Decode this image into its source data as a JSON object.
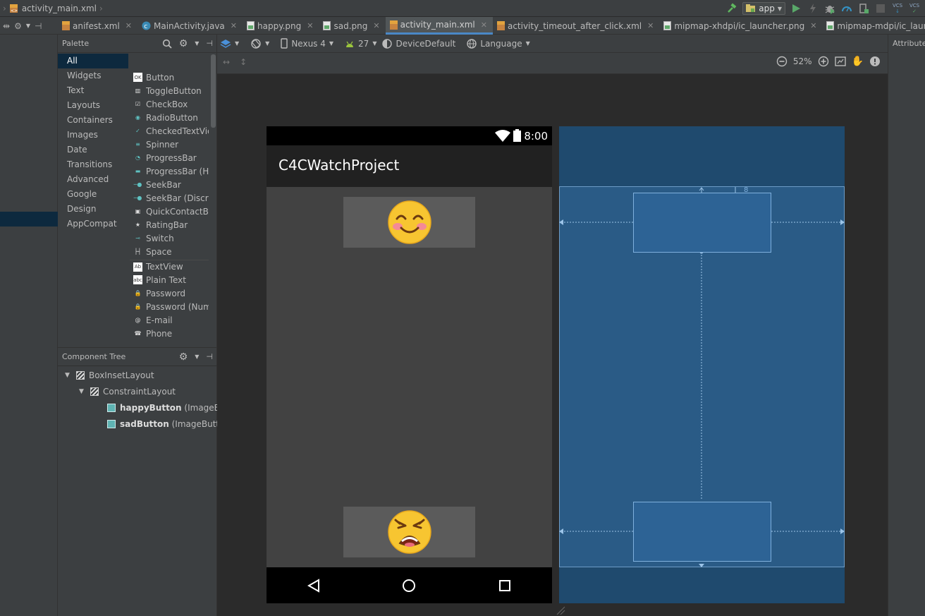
{
  "breadcrumb": {
    "file": "activity_main.xml",
    "separator": "›"
  },
  "run_config": {
    "label": "app"
  },
  "vcs": {
    "label": "VCS"
  },
  "tabs": [
    {
      "label": "anifest.xml",
      "icon": "xml-file-icon",
      "active": false
    },
    {
      "label": "MainActivity.java",
      "icon": "java-class-icon",
      "active": false
    },
    {
      "label": "happy.png",
      "icon": "image-file-icon",
      "active": false
    },
    {
      "label": "sad.png",
      "icon": "image-file-icon",
      "active": false
    },
    {
      "label": "activity_main.xml",
      "icon": "xml-file-icon",
      "active": true
    },
    {
      "label": "activity_timeout_after_click.xml",
      "icon": "xml-file-icon",
      "active": false
    },
    {
      "label": "mipmap-xhdpi/ic_launcher.png",
      "icon": "image-file-icon",
      "active": false
    },
    {
      "label": "mipmap-mdpi/ic_launcher.png",
      "icon": "image-file-icon",
      "active": false
    }
  ],
  "palette": {
    "title": "Palette",
    "categories": [
      "All",
      "Widgets",
      "Text",
      "Layouts",
      "Containers",
      "Images",
      "Date",
      "Transitions",
      "Advanced",
      "Google",
      "Design",
      "AppCompat"
    ],
    "selected_category": "All",
    "widgets": [
      "Button",
      "ToggleButton",
      "CheckBox",
      "RadioButton",
      "CheckedTextView",
      "Spinner",
      "ProgressBar",
      "ProgressBar (Horizontal)",
      "SeekBar",
      "SeekBar (Discrete)",
      "QuickContactBadge",
      "RatingBar",
      "Switch",
      "Space",
      "TextView",
      "Plain Text",
      "Password",
      "Password (Numeric)",
      "E-mail",
      "Phone"
    ]
  },
  "component_tree": {
    "title": "Component Tree",
    "nodes": [
      {
        "name": "BoxInsetLayout",
        "type": ""
      },
      {
        "name": "ConstraintLayout",
        "type": ""
      },
      {
        "name": "happyButton",
        "type": "(ImageButton)"
      },
      {
        "name": "sadButton",
        "type": "(ImageButton)"
      }
    ]
  },
  "design_toolbar": {
    "device": "Nexus 4",
    "api": "27",
    "theme": "DeviceDefault",
    "language": "Language",
    "zoom": "52%"
  },
  "phone_preview": {
    "time": "8:00",
    "app_title": "C4CWatchProject",
    "happy_emoji": "smiling-face",
    "sad_emoji": "tired-face"
  },
  "blueprint": {
    "margin_label": "8"
  },
  "attributes": {
    "title": "Attributes"
  },
  "colors": {
    "ide_background": "#2b2b2b",
    "panel": "#3c3f41",
    "selection": "#0d293e",
    "accent_tab": "#4a88c7",
    "blueprint_bg": "#1f4a6e",
    "blueprint_layout": "#2a5b86",
    "phone_bg": "#424242"
  }
}
